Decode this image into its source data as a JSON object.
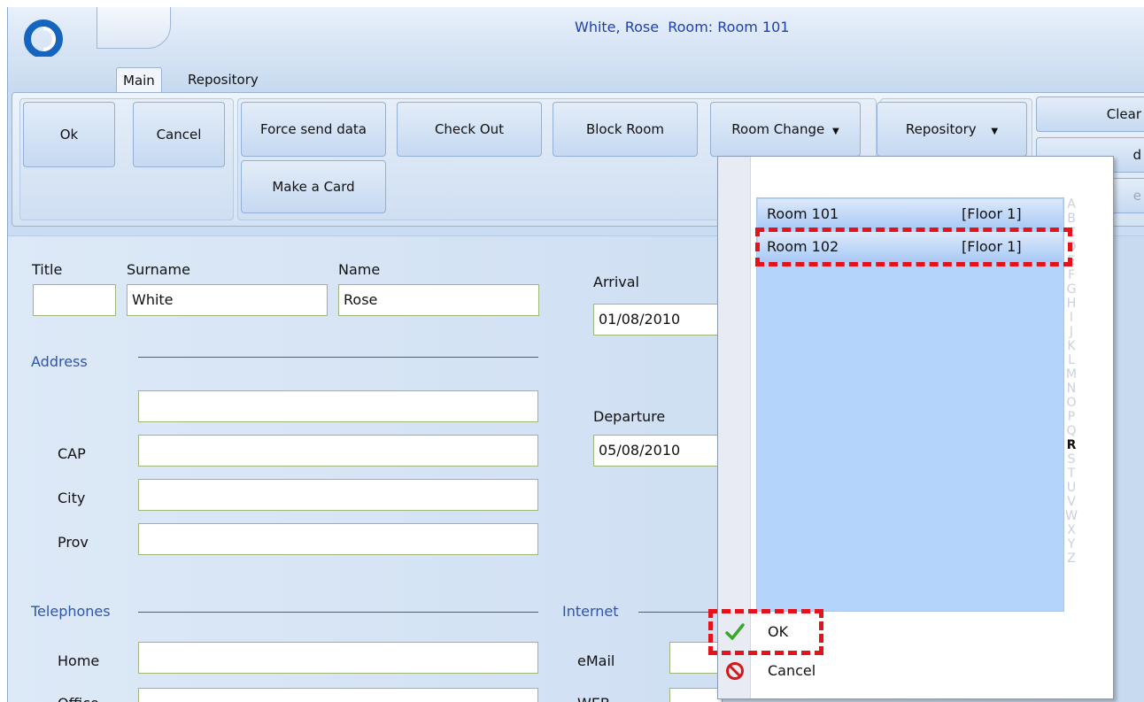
{
  "window": {
    "title": "White, Rose  Room: Room 101"
  },
  "tabs": [
    {
      "label": "Main"
    },
    {
      "label": "Repository"
    }
  ],
  "ribbon": {
    "ok": "Ok",
    "cancel": "Cancel",
    "force_send": "Force send data",
    "make_card": "Make a Card",
    "check_out": "Check Out",
    "block_room": "Block Room",
    "room_change": "Room Change",
    "repository": "Repository",
    "clear": "Clear",
    "partial_1": "d",
    "partial_2": "e"
  },
  "form": {
    "title": {
      "label": "Title",
      "value": ""
    },
    "surname": {
      "label": "Surname",
      "value": "White"
    },
    "name": {
      "label": "Name",
      "value": "Rose"
    },
    "arrival": {
      "label": "Arrival",
      "value": "01/08/2010"
    },
    "departure": {
      "label": "Departure",
      "value": "05/08/2010"
    },
    "address": {
      "section": "Address",
      "line1": ""
    },
    "cap": {
      "label": "CAP",
      "value": ""
    },
    "city": {
      "label": "City",
      "value": ""
    },
    "prov": {
      "label": "Prov",
      "value": ""
    },
    "telephones": {
      "section": "Telephones"
    },
    "home": {
      "label": "Home",
      "value": ""
    },
    "office": {
      "label": "Office",
      "value": ""
    },
    "internet": {
      "section": "Internet"
    },
    "email": {
      "label": "eMail",
      "value": ""
    },
    "web": {
      "label": "WEB",
      "value": ""
    }
  },
  "room_popup": {
    "rooms": [
      {
        "name": "Room 101",
        "floor": "[Floor 1]"
      },
      {
        "name": "Room 102",
        "floor": "[Floor 1]"
      }
    ],
    "alphabet": [
      "A",
      "B",
      "C",
      "D",
      "E",
      "F",
      "G",
      "H",
      "I",
      "J",
      "K",
      "L",
      "M",
      "N",
      "O",
      "P",
      "Q",
      "R",
      "S",
      "T",
      "U",
      "V",
      "W",
      "X",
      "Y",
      "Z"
    ],
    "active_letter": "R",
    "ok_label": "OK",
    "cancel_label": "Cancel"
  },
  "colors": {
    "accent": "#1f3fb0",
    "highlight": "#e3121b",
    "list_bg": "#b4d4fb"
  }
}
